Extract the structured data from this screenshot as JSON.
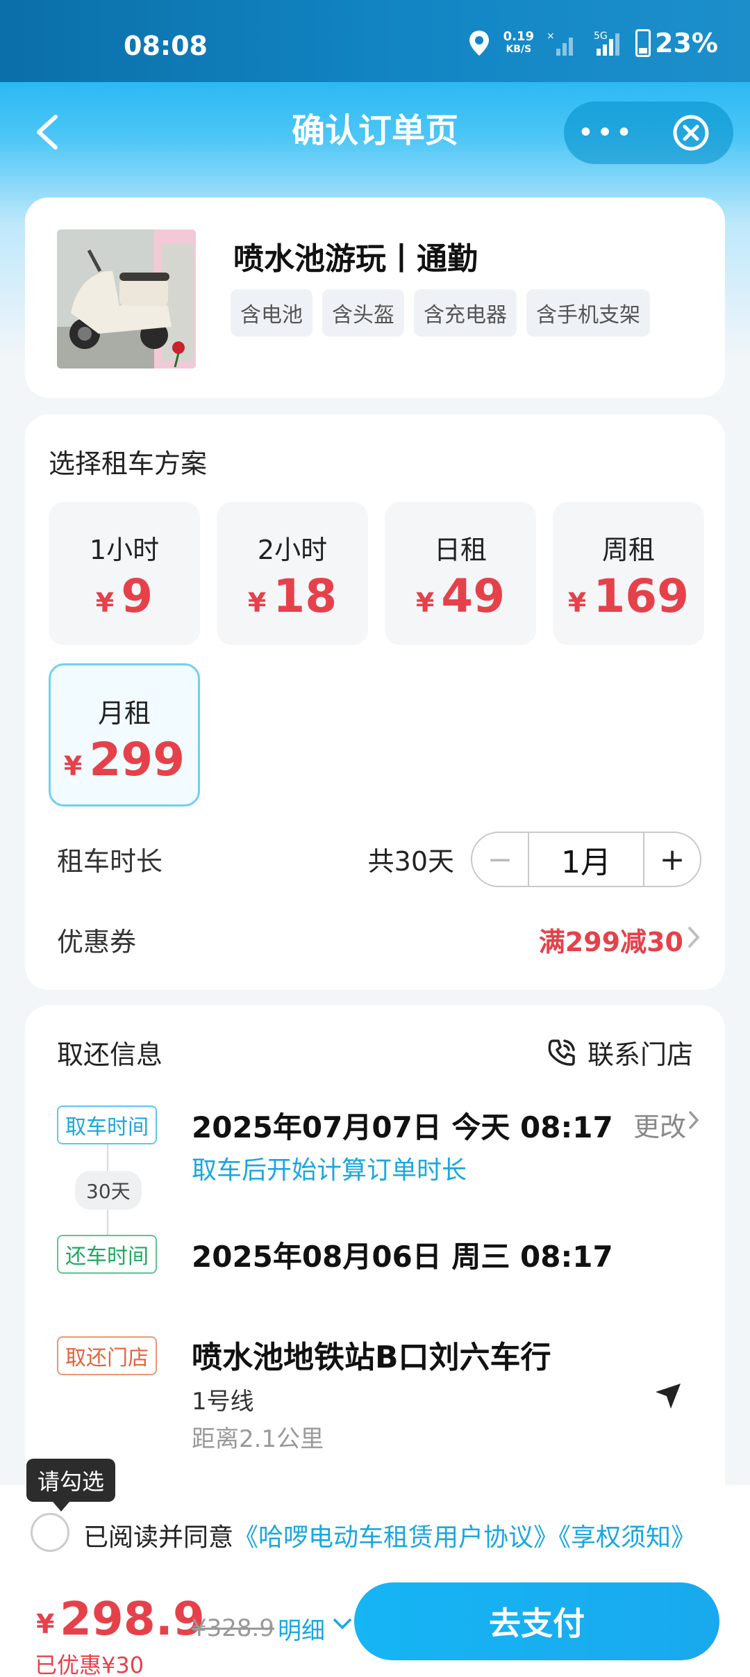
{
  "status_bar": {
    "time": "08:08",
    "net_speed": "0.19",
    "net_unit": "KB/S",
    "network": "5G",
    "battery": "23%"
  },
  "nav": {
    "title": "确认订单页",
    "more": "•••"
  },
  "product": {
    "name": "喷水池游玩丨通勤",
    "tags": [
      "含电池",
      "含头盔",
      "含充电器",
      "含手机支架"
    ]
  },
  "plans": {
    "title": "选择租车方案",
    "currency": "¥",
    "options": [
      {
        "label": "1小时",
        "price": "9"
      },
      {
        "label": "2小时",
        "price": "18"
      },
      {
        "label": "日租",
        "price": "49"
      },
      {
        "label": "周租",
        "price": "169"
      },
      {
        "label": "月租",
        "price": "299"
      }
    ],
    "selected_index": 4
  },
  "duration": {
    "label": "租车时长",
    "total": "共30天",
    "minus": "−",
    "value": "1月",
    "plus": "+"
  },
  "coupon": {
    "label": "优惠券",
    "value": "满299减30"
  },
  "pickup": {
    "title": "取还信息",
    "contact": "联系门店",
    "pick_badge": "取车时间",
    "pick_time": "2025年07月07日 今天 08:17",
    "change": "更改",
    "hint": "取车后开始计算订单时长",
    "days": "30天",
    "return_badge": "还车时间",
    "return_time": "2025年08月06日 周三 08:17",
    "store_badge": "取还门店",
    "store_name": "喷水池地铁站B口刘六车行",
    "store_line": "1号线",
    "store_distance": "距离2.1公里"
  },
  "agreement": {
    "tooltip": "请勾选",
    "text": "已阅读并同意",
    "link1": "《哈啰电动车租赁用户协议》",
    "link2": "《享权须知》"
  },
  "footer": {
    "currency": "¥",
    "price": "298.9",
    "original": "¥328.9",
    "detail": "明细",
    "saved": "已优惠¥30",
    "pay": "去支付"
  },
  "colors": {
    "accent": "#1aa7de",
    "price": "#e6414a"
  }
}
